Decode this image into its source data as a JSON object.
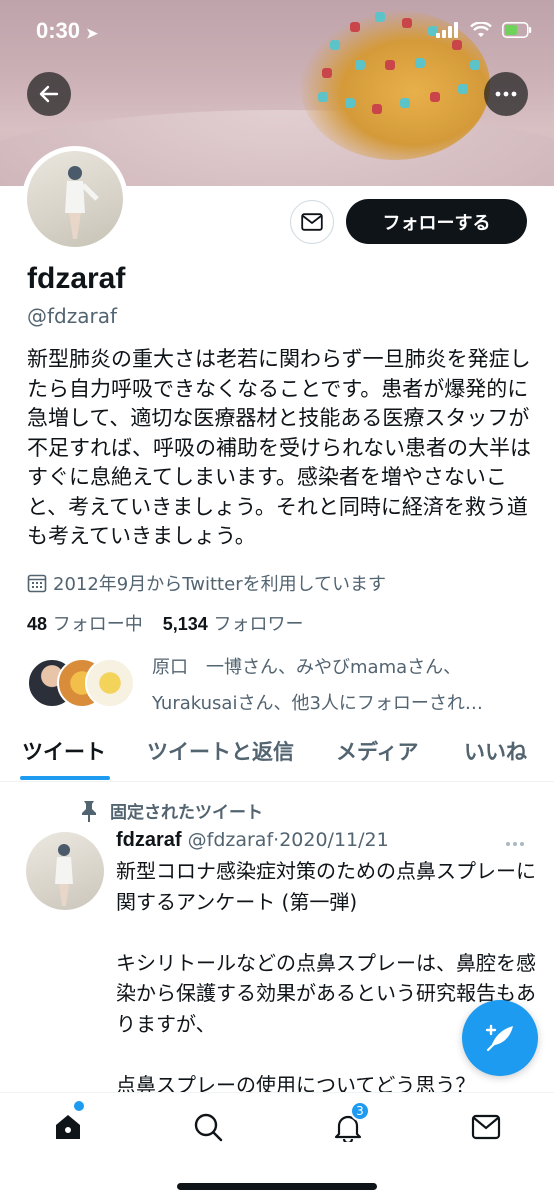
{
  "status_bar": {
    "time": "0:30"
  },
  "profile": {
    "display_name": "fdzaraf",
    "handle": "@fdzaraf",
    "bio": "新型肺炎の重大さは老若に関わらず一旦肺炎を発症したら自力呼吸できなくなることです。患者が爆発的に急増して、適切な医療器材と技能ある医療スタッフが不足すれば、呼吸の補助を受けられない患者の大半はすぐに息絶えてしまいます。感染者を増やさないこと、考えていきましょう。それと同時に経済を救う道も考えていきましょう。",
    "joined": "2012年9月からTwitterを利用しています",
    "following_count": "48",
    "following_label": "フォロー中",
    "followers_count": "5,134",
    "followers_label": "フォロワー",
    "mutual_followers_line1": "原口　一博さん、みやびmamaさん、",
    "mutual_followers_line2": "Yurakusaiさん、他3人にフォローされ…",
    "follow_button_label": "フォローする"
  },
  "tabs": [
    {
      "label": "ツイート",
      "active": true
    },
    {
      "label": "ツイートと返信",
      "active": false
    },
    {
      "label": "メディア",
      "active": false
    },
    {
      "label": "いいね",
      "active": false
    }
  ],
  "tweet": {
    "pinned_label": "固定されたツイート",
    "author_name": "fdzaraf",
    "author_handle": "@fdzaraf",
    "separator": "·",
    "date": "2020/11/21",
    "body": "新型コロナ感染症対策のための点鼻スプレーに関するアンケート (第一弾)\n\nキシリトールなどの点鼻スプレーは、鼻腔を感染から保護する効果があるという研究報告もありますが、\n\n点鼻スプレーの使用についてどう思う？"
  },
  "bottom_nav": {
    "notifications_badge": "3"
  },
  "colors": {
    "accent": "#1d9bf0",
    "text_primary": "#0f1419",
    "text_secondary": "#536471"
  },
  "icons": [
    "back-arrow-icon",
    "more-horizontal-icon",
    "mail-icon",
    "calendar-icon",
    "pin-icon",
    "compose-tweet-icon",
    "home-icon",
    "search-icon",
    "notifications-bell-icon",
    "messages-envelope-icon",
    "signal-icon",
    "wifi-icon",
    "battery-icon",
    "location-arrow-icon"
  ]
}
